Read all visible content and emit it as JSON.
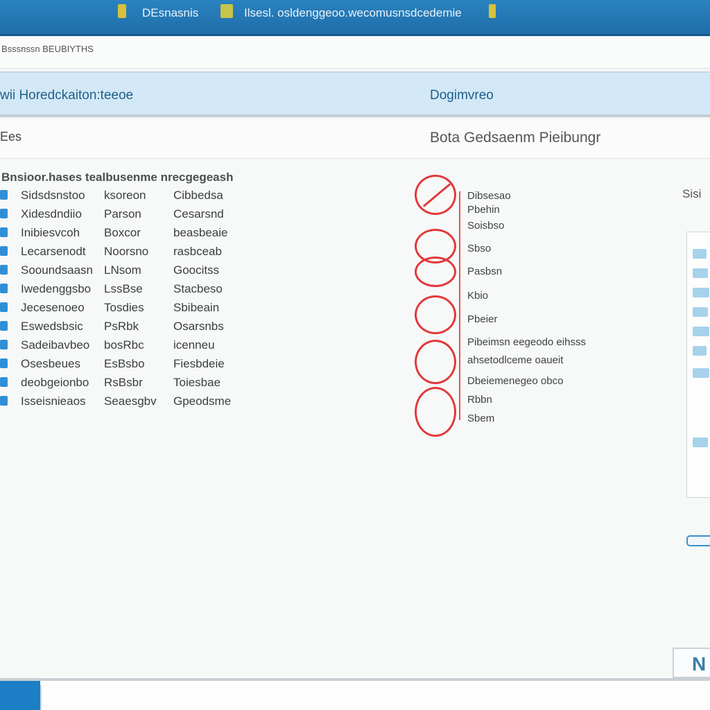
{
  "titlebar": {
    "app_label": "DEsnasnis",
    "window_title": "Ilsesl. osldenggeoo.wecomusnsdcedemie",
    "icons": [
      "app-icon",
      "folder-icon",
      "pin-icon"
    ]
  },
  "menubar": {
    "text": "Bsssnssn BEUBIYTHS"
  },
  "banner": {
    "left": "wii Horedckaiton:teeoe",
    "right": "Dogimvreo"
  },
  "subhead": {
    "left": "Ees",
    "right": "Bota Gedsaenm Pieibungr"
  },
  "list": {
    "header": "Bnsioor.hases tealbusenme nrecgegeash",
    "rows": [
      {
        "c1": "Sidsdsnstoo",
        "c2": "ksoreon",
        "c3": "Cibbedsa"
      },
      {
        "c1": "Xidesdndiio",
        "c2": "Parson",
        "c3": "Cesarsnd"
      },
      {
        "c1": "Inibiesvcoh",
        "c2": "Boxcor",
        "c3": "beasbeaie"
      },
      {
        "c1": "Lecarsenodt",
        "c2": "Noorsno",
        "c3": "rasbceab"
      },
      {
        "c1": "Sooundsaasn",
        "c2": "LNsom",
        "c3": "Goocitss"
      },
      {
        "c1": "Iwedenggsbo",
        "c2": "LssBse",
        "c3": "Stacbeso"
      },
      {
        "c1": "Jecesenoeo",
        "c2": "Tosdies",
        "c3": "Sbibeain"
      },
      {
        "c1": "Eswedsbsic",
        "c2": "PsRbk",
        "c3": "Osarsnbs"
      },
      {
        "c1": "Sadeibavbeo",
        "c2": "bosRbc",
        "c3": "icenneu"
      },
      {
        "c1": "Osesbeues",
        "c2": "EsBsbo",
        "c3": "Fiesbdeie"
      },
      {
        "c1": "deobgeionbo",
        "c2": "RsBsbr",
        "c3": "Toiesbae"
      },
      {
        "c1": "Isseisnieaos",
        "c2": "Seaesgbv",
        "c3": "Gpeodsme"
      }
    ]
  },
  "status": {
    "labels": [
      "Dibsesao",
      "Pbehin",
      "Soisbso",
      "Sbso",
      "Pasbsn",
      "Kbio",
      "Pbeier",
      "Pibeimsn eegeodo eihsss",
      "ahsetodlceme oaueit",
      "Dbeiemenegeo obco",
      "Rbbn",
      "Sbem"
    ],
    "accent_color": "#e2393b"
  },
  "right_panel": {
    "label": "Sisi"
  },
  "corner_button": {
    "label": "N"
  }
}
